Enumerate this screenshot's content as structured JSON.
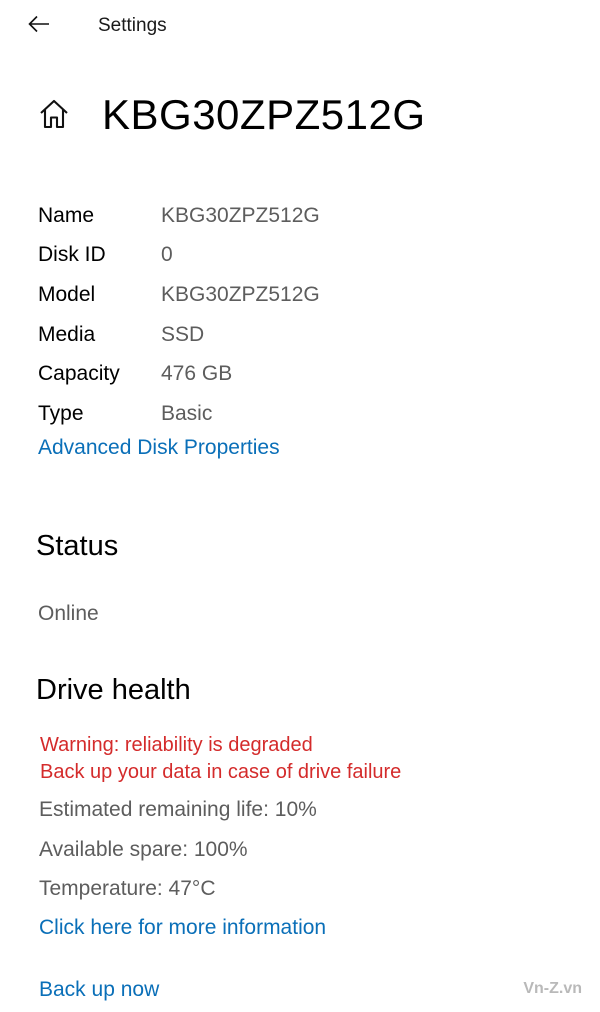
{
  "header": {
    "app_title": "Settings",
    "back_icon": "arrow-left-icon"
  },
  "page": {
    "home_icon": "home-icon",
    "title": "KBG30ZPZ512G"
  },
  "properties": [
    {
      "label": "Name",
      "value": "KBG30ZPZ512G"
    },
    {
      "label": "Disk ID",
      "value": "0"
    },
    {
      "label": "Model",
      "value": "KBG30ZPZ512G"
    },
    {
      "label": "Media",
      "value": "SSD"
    },
    {
      "label": "Capacity",
      "value": "476 GB"
    },
    {
      "label": "Type",
      "value": "Basic"
    }
  ],
  "advanced_link": "Advanced Disk Properties",
  "status": {
    "heading": "Status",
    "value": "Online"
  },
  "drive_health": {
    "heading": "Drive health",
    "warning_line1": "Warning: reliability is degraded",
    "warning_line2": "Back up your data in case of drive failure",
    "remaining_life": "Estimated remaining life: 10%",
    "available_spare": "Available spare: 100%",
    "temperature": "Temperature: 47°C",
    "more_info_link": "Click here for more information",
    "backup_link": "Back up now"
  },
  "watermark": "Vn-Z.vn",
  "colors": {
    "link": "#0a6fb8",
    "warning": "#d42b2b",
    "secondary_text": "#5d5d5d"
  }
}
